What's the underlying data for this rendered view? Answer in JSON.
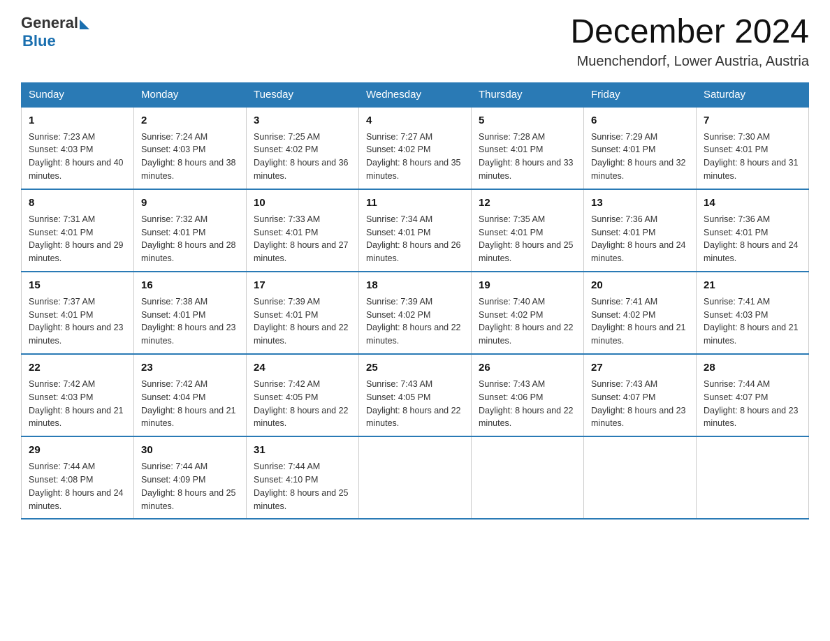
{
  "logo": {
    "general": "General",
    "blue": "Blue",
    "arrow": "▶"
  },
  "title": "December 2024",
  "location": "Muenchendorf, Lower Austria, Austria",
  "days_of_week": [
    "Sunday",
    "Monday",
    "Tuesday",
    "Wednesday",
    "Thursday",
    "Friday",
    "Saturday"
  ],
  "weeks": [
    [
      {
        "day": 1,
        "sunrise": "7:23 AM",
        "sunset": "4:03 PM",
        "daylight": "8 hours and 40 minutes."
      },
      {
        "day": 2,
        "sunrise": "7:24 AM",
        "sunset": "4:03 PM",
        "daylight": "8 hours and 38 minutes."
      },
      {
        "day": 3,
        "sunrise": "7:25 AM",
        "sunset": "4:02 PM",
        "daylight": "8 hours and 36 minutes."
      },
      {
        "day": 4,
        "sunrise": "7:27 AM",
        "sunset": "4:02 PM",
        "daylight": "8 hours and 35 minutes."
      },
      {
        "day": 5,
        "sunrise": "7:28 AM",
        "sunset": "4:01 PM",
        "daylight": "8 hours and 33 minutes."
      },
      {
        "day": 6,
        "sunrise": "7:29 AM",
        "sunset": "4:01 PM",
        "daylight": "8 hours and 32 minutes."
      },
      {
        "day": 7,
        "sunrise": "7:30 AM",
        "sunset": "4:01 PM",
        "daylight": "8 hours and 31 minutes."
      }
    ],
    [
      {
        "day": 8,
        "sunrise": "7:31 AM",
        "sunset": "4:01 PM",
        "daylight": "8 hours and 29 minutes."
      },
      {
        "day": 9,
        "sunrise": "7:32 AM",
        "sunset": "4:01 PM",
        "daylight": "8 hours and 28 minutes."
      },
      {
        "day": 10,
        "sunrise": "7:33 AM",
        "sunset": "4:01 PM",
        "daylight": "8 hours and 27 minutes."
      },
      {
        "day": 11,
        "sunrise": "7:34 AM",
        "sunset": "4:01 PM",
        "daylight": "8 hours and 26 minutes."
      },
      {
        "day": 12,
        "sunrise": "7:35 AM",
        "sunset": "4:01 PM",
        "daylight": "8 hours and 25 minutes."
      },
      {
        "day": 13,
        "sunrise": "7:36 AM",
        "sunset": "4:01 PM",
        "daylight": "8 hours and 24 minutes."
      },
      {
        "day": 14,
        "sunrise": "7:36 AM",
        "sunset": "4:01 PM",
        "daylight": "8 hours and 24 minutes."
      }
    ],
    [
      {
        "day": 15,
        "sunrise": "7:37 AM",
        "sunset": "4:01 PM",
        "daylight": "8 hours and 23 minutes."
      },
      {
        "day": 16,
        "sunrise": "7:38 AM",
        "sunset": "4:01 PM",
        "daylight": "8 hours and 23 minutes."
      },
      {
        "day": 17,
        "sunrise": "7:39 AM",
        "sunset": "4:01 PM",
        "daylight": "8 hours and 22 minutes."
      },
      {
        "day": 18,
        "sunrise": "7:39 AM",
        "sunset": "4:02 PM",
        "daylight": "8 hours and 22 minutes."
      },
      {
        "day": 19,
        "sunrise": "7:40 AM",
        "sunset": "4:02 PM",
        "daylight": "8 hours and 22 minutes."
      },
      {
        "day": 20,
        "sunrise": "7:41 AM",
        "sunset": "4:02 PM",
        "daylight": "8 hours and 21 minutes."
      },
      {
        "day": 21,
        "sunrise": "7:41 AM",
        "sunset": "4:03 PM",
        "daylight": "8 hours and 21 minutes."
      }
    ],
    [
      {
        "day": 22,
        "sunrise": "7:42 AM",
        "sunset": "4:03 PM",
        "daylight": "8 hours and 21 minutes."
      },
      {
        "day": 23,
        "sunrise": "7:42 AM",
        "sunset": "4:04 PM",
        "daylight": "8 hours and 21 minutes."
      },
      {
        "day": 24,
        "sunrise": "7:42 AM",
        "sunset": "4:05 PM",
        "daylight": "8 hours and 22 minutes."
      },
      {
        "day": 25,
        "sunrise": "7:43 AM",
        "sunset": "4:05 PM",
        "daylight": "8 hours and 22 minutes."
      },
      {
        "day": 26,
        "sunrise": "7:43 AM",
        "sunset": "4:06 PM",
        "daylight": "8 hours and 22 minutes."
      },
      {
        "day": 27,
        "sunrise": "7:43 AM",
        "sunset": "4:07 PM",
        "daylight": "8 hours and 23 minutes."
      },
      {
        "day": 28,
        "sunrise": "7:44 AM",
        "sunset": "4:07 PM",
        "daylight": "8 hours and 23 minutes."
      }
    ],
    [
      {
        "day": 29,
        "sunrise": "7:44 AM",
        "sunset": "4:08 PM",
        "daylight": "8 hours and 24 minutes."
      },
      {
        "day": 30,
        "sunrise": "7:44 AM",
        "sunset": "4:09 PM",
        "daylight": "8 hours and 25 minutes."
      },
      {
        "day": 31,
        "sunrise": "7:44 AM",
        "sunset": "4:10 PM",
        "daylight": "8 hours and 25 minutes."
      },
      null,
      null,
      null,
      null
    ]
  ]
}
